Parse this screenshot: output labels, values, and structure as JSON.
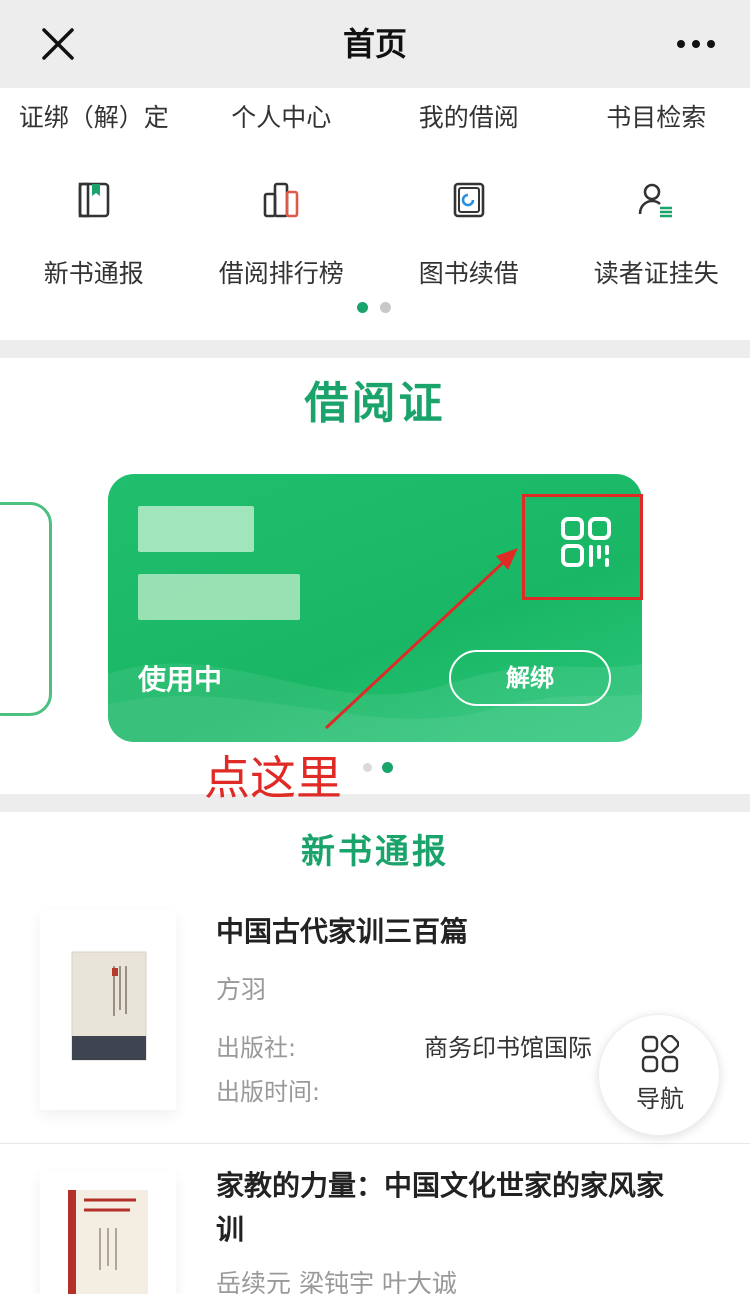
{
  "header": {
    "title": "首页"
  },
  "quick_nav": {
    "row1": [
      "证绑（解）定",
      "个人中心",
      "我的借阅",
      "书目检索"
    ],
    "row2": [
      {
        "label": "新书通报",
        "icon": "book-icon"
      },
      {
        "label": "借阅排行榜",
        "icon": "bar-chart-icon"
      },
      {
        "label": "图书续借",
        "icon": "renew-book-icon"
      },
      {
        "label": "读者证挂失",
        "icon": "user-list-icon"
      }
    ],
    "page_dots": {
      "active": 0,
      "count": 2
    }
  },
  "card_section": {
    "title": "借阅证",
    "card": {
      "status": "使用中",
      "unbind_label": "解绑",
      "qr_icon": "qr-code-icon"
    },
    "annotation": "点这里",
    "colors": {
      "accent": "#1aa36a",
      "card": "#1fbf6e",
      "annotation": "#e02a26"
    }
  },
  "new_books": {
    "title": "新书通报",
    "books": [
      {
        "title": "中国古代家训三百篇",
        "author": "方羽",
        "publisher_label": "出版社:",
        "publisher": "商务印书馆国际",
        "pubdate_label": "出版时间:",
        "pubdate": ""
      },
      {
        "title_line1": "家教的力量：中国文化世家的家风家",
        "title_line2": "训",
        "author": "岳续元  梁钝宇  叶大诚"
      }
    ]
  },
  "float_nav": {
    "label": "导航",
    "icon": "grid-icon"
  }
}
